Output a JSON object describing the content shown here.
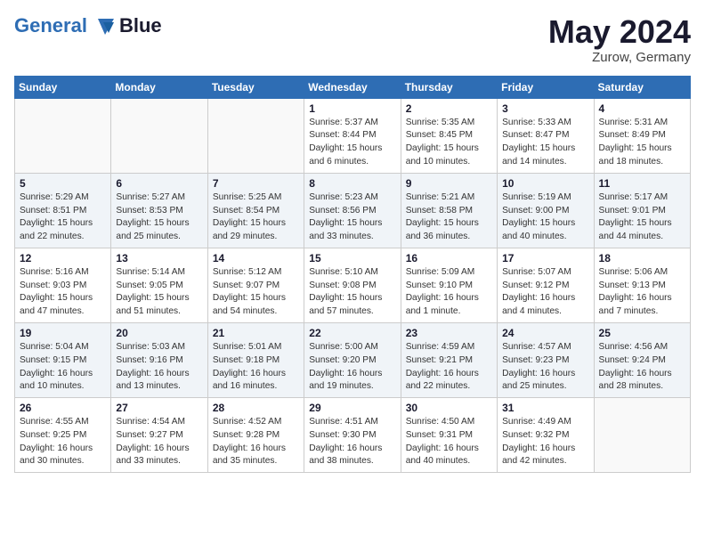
{
  "header": {
    "logo_line1": "General",
    "logo_line2": "Blue",
    "month_year": "May 2024",
    "location": "Zurow, Germany"
  },
  "weekdays": [
    "Sunday",
    "Monday",
    "Tuesday",
    "Wednesday",
    "Thursday",
    "Friday",
    "Saturday"
  ],
  "weeks": [
    [
      {
        "day": "",
        "info": ""
      },
      {
        "day": "",
        "info": ""
      },
      {
        "day": "",
        "info": ""
      },
      {
        "day": "1",
        "info": "Sunrise: 5:37 AM\nSunset: 8:44 PM\nDaylight: 15 hours\nand 6 minutes."
      },
      {
        "day": "2",
        "info": "Sunrise: 5:35 AM\nSunset: 8:45 PM\nDaylight: 15 hours\nand 10 minutes."
      },
      {
        "day": "3",
        "info": "Sunrise: 5:33 AM\nSunset: 8:47 PM\nDaylight: 15 hours\nand 14 minutes."
      },
      {
        "day": "4",
        "info": "Sunrise: 5:31 AM\nSunset: 8:49 PM\nDaylight: 15 hours\nand 18 minutes."
      }
    ],
    [
      {
        "day": "5",
        "info": "Sunrise: 5:29 AM\nSunset: 8:51 PM\nDaylight: 15 hours\nand 22 minutes."
      },
      {
        "day": "6",
        "info": "Sunrise: 5:27 AM\nSunset: 8:53 PM\nDaylight: 15 hours\nand 25 minutes."
      },
      {
        "day": "7",
        "info": "Sunrise: 5:25 AM\nSunset: 8:54 PM\nDaylight: 15 hours\nand 29 minutes."
      },
      {
        "day": "8",
        "info": "Sunrise: 5:23 AM\nSunset: 8:56 PM\nDaylight: 15 hours\nand 33 minutes."
      },
      {
        "day": "9",
        "info": "Sunrise: 5:21 AM\nSunset: 8:58 PM\nDaylight: 15 hours\nand 36 minutes."
      },
      {
        "day": "10",
        "info": "Sunrise: 5:19 AM\nSunset: 9:00 PM\nDaylight: 15 hours\nand 40 minutes."
      },
      {
        "day": "11",
        "info": "Sunrise: 5:17 AM\nSunset: 9:01 PM\nDaylight: 15 hours\nand 44 minutes."
      }
    ],
    [
      {
        "day": "12",
        "info": "Sunrise: 5:16 AM\nSunset: 9:03 PM\nDaylight: 15 hours\nand 47 minutes."
      },
      {
        "day": "13",
        "info": "Sunrise: 5:14 AM\nSunset: 9:05 PM\nDaylight: 15 hours\nand 51 minutes."
      },
      {
        "day": "14",
        "info": "Sunrise: 5:12 AM\nSunset: 9:07 PM\nDaylight: 15 hours\nand 54 minutes."
      },
      {
        "day": "15",
        "info": "Sunrise: 5:10 AM\nSunset: 9:08 PM\nDaylight: 15 hours\nand 57 minutes."
      },
      {
        "day": "16",
        "info": "Sunrise: 5:09 AM\nSunset: 9:10 PM\nDaylight: 16 hours\nand 1 minute."
      },
      {
        "day": "17",
        "info": "Sunrise: 5:07 AM\nSunset: 9:12 PM\nDaylight: 16 hours\nand 4 minutes."
      },
      {
        "day": "18",
        "info": "Sunrise: 5:06 AM\nSunset: 9:13 PM\nDaylight: 16 hours\nand 7 minutes."
      }
    ],
    [
      {
        "day": "19",
        "info": "Sunrise: 5:04 AM\nSunset: 9:15 PM\nDaylight: 16 hours\nand 10 minutes."
      },
      {
        "day": "20",
        "info": "Sunrise: 5:03 AM\nSunset: 9:16 PM\nDaylight: 16 hours\nand 13 minutes."
      },
      {
        "day": "21",
        "info": "Sunrise: 5:01 AM\nSunset: 9:18 PM\nDaylight: 16 hours\nand 16 minutes."
      },
      {
        "day": "22",
        "info": "Sunrise: 5:00 AM\nSunset: 9:20 PM\nDaylight: 16 hours\nand 19 minutes."
      },
      {
        "day": "23",
        "info": "Sunrise: 4:59 AM\nSunset: 9:21 PM\nDaylight: 16 hours\nand 22 minutes."
      },
      {
        "day": "24",
        "info": "Sunrise: 4:57 AM\nSunset: 9:23 PM\nDaylight: 16 hours\nand 25 minutes."
      },
      {
        "day": "25",
        "info": "Sunrise: 4:56 AM\nSunset: 9:24 PM\nDaylight: 16 hours\nand 28 minutes."
      }
    ],
    [
      {
        "day": "26",
        "info": "Sunrise: 4:55 AM\nSunset: 9:25 PM\nDaylight: 16 hours\nand 30 minutes."
      },
      {
        "day": "27",
        "info": "Sunrise: 4:54 AM\nSunset: 9:27 PM\nDaylight: 16 hours\nand 33 minutes."
      },
      {
        "day": "28",
        "info": "Sunrise: 4:52 AM\nSunset: 9:28 PM\nDaylight: 16 hours\nand 35 minutes."
      },
      {
        "day": "29",
        "info": "Sunrise: 4:51 AM\nSunset: 9:30 PM\nDaylight: 16 hours\nand 38 minutes."
      },
      {
        "day": "30",
        "info": "Sunrise: 4:50 AM\nSunset: 9:31 PM\nDaylight: 16 hours\nand 40 minutes."
      },
      {
        "day": "31",
        "info": "Sunrise: 4:49 AM\nSunset: 9:32 PM\nDaylight: 16 hours\nand 42 minutes."
      },
      {
        "day": "",
        "info": ""
      }
    ]
  ]
}
